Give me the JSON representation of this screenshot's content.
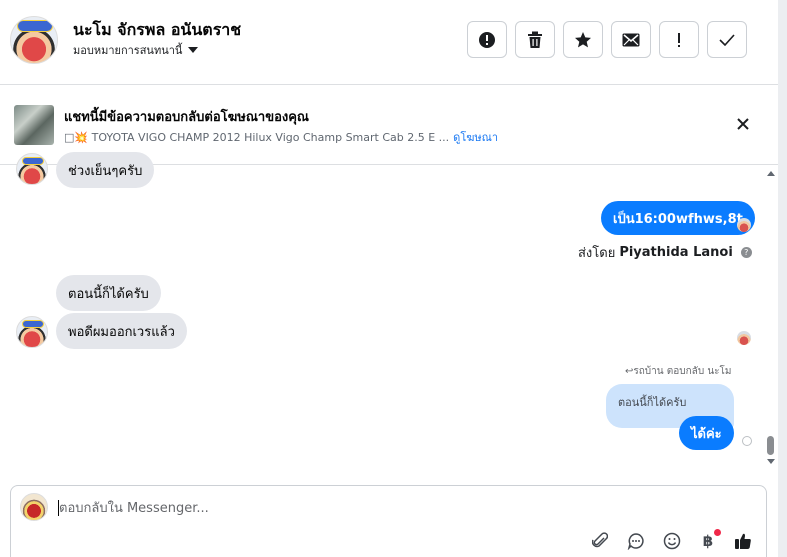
{
  "header": {
    "contact_name": "นะโม จักรพล อนันตราช",
    "assign_label": "มอบหมายการสนทนานี้",
    "actions": [
      {
        "name": "spam-button",
        "icon": "alert-circle-icon"
      },
      {
        "name": "delete-button",
        "icon": "trash-icon"
      },
      {
        "name": "star-button",
        "icon": "star-icon"
      },
      {
        "name": "mark-unread-button",
        "icon": "envelope-icon"
      },
      {
        "name": "follow-up-button",
        "icon": "exclamation-icon"
      },
      {
        "name": "done-button",
        "icon": "check-icon"
      }
    ]
  },
  "ad_banner": {
    "title": "แชทนี้มีข้อความตอบกลับต่อโฆษณาของคุณ",
    "subtitle": "💥 TOYOTA VIGO CHAMP 2012 Hilux Vigo Champ Smart Cab 2.5 E ...",
    "subtitle_prefix": "□",
    "link": "ดูโฆษณา"
  },
  "messages": {
    "in_1": "ช่วงเย็นๆครับ",
    "out_1": "เป็น16:00wfhws,8t",
    "sent_by_prefix": "ส่งโดย",
    "sent_by_name": "Piyathida Lanoi",
    "in_2": "ตอนนี้ก็ได้ครับ",
    "in_3": "พอดีผมออกเวรแล้ว",
    "reply_label": "↩รถบ้าน ตอบกลับ นะโม",
    "quoted_text": "ตอนนี้ก็ได้ครับ",
    "out_2": "ได้ค่ะ"
  },
  "composer": {
    "placeholder": "ตอบกลับใน Messenger...",
    "tools": [
      "paperclip-icon",
      "saved-reply-icon",
      "emoji-icon",
      "baht-icon",
      "thumbs-up-icon"
    ]
  },
  "colors": {
    "accent": "#0a7cff",
    "incoming_bubble": "#e4e6eb",
    "quoted_bubble": "#cde3fc",
    "notification": "#f02849"
  }
}
